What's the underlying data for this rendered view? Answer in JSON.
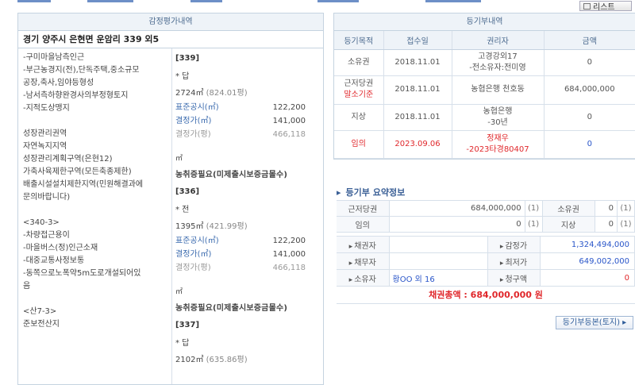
{
  "toolbar": {
    "print_label": "리스트"
  },
  "appraisal": {
    "header": "감정평가내역",
    "address": "경기 양주시 은현면 운암리 339 외5",
    "desc": [
      "-구미마을남측인근",
      "-부근농경지(전),단독주택,중소규모",
      "공장,축사,임야등형성",
      "-남서측하향완경사의부정형토지",
      "-지적도상맹지",
      "",
      "성장관리권역",
      "자연녹지지역",
      "성장관리계획구역(은현12)",
      "가축사육제한구역(모든축종제한)",
      "배출시설설치제한지역(민원해결과에",
      "문의바랍니다)",
      "",
      "<340-3>",
      "-차량접근용이",
      "-마을버스(정)인근소재",
      "-대중교통사정보통",
      "-동쪽으로노폭약5m도로개설되어있",
      "음",
      "",
      "<산7-3>",
      "준보전산지"
    ],
    "lots": [
      {
        "lot": "[339]",
        "kind": "* 답",
        "area": "2724㎡",
        "area_py": "(824.01평)",
        "official_label": "표준공시(㎡)",
        "official_value": "122,200",
        "decided_label": "결정가(㎡)",
        "decided_value": "141,000",
        "py_label": "결정가(평)",
        "py_value": "466,118",
        "unit": "㎡",
        "note": "농취증필요(미제출시보증금몰수)"
      },
      {
        "lot": "[336]",
        "kind": "* 전",
        "area": "1395㎡",
        "area_py": "(421.99평)",
        "official_label": "표준공시(㎡)",
        "official_value": "122,200",
        "decided_label": "결정가(㎡)",
        "decided_value": "141,000",
        "py_label": "결정가(평)",
        "py_value": "466,118",
        "unit": "㎡",
        "note": "농취증필요(미제출시보증금몰수)"
      },
      {
        "lot": "[337]",
        "kind": "* 답",
        "area": "2102㎡",
        "area_py": "(635.86평)"
      }
    ]
  },
  "registry": {
    "header": "등기부내역",
    "columns": [
      "등기목적",
      "접수일",
      "권리자",
      "금액"
    ],
    "rows": [
      {
        "purpose": "소유권",
        "purpose2": "",
        "date": "2018.11.01",
        "holder": "고경강외17",
        "holder2": "-전소유자:전미영",
        "amount": "0"
      },
      {
        "purpose": "근저당권",
        "purpose2": "말소기준",
        "date": "2018.11.01",
        "holder": "농협은행 천호동",
        "holder2": "",
        "amount": "684,000,000"
      },
      {
        "purpose": "지상",
        "purpose2": "",
        "date": "2018.11.01",
        "holder": "농협은행",
        "holder2": "-30년",
        "amount": "0"
      },
      {
        "purpose": "임의",
        "purpose2": "",
        "date": "2023.09.06",
        "holder": "정재우",
        "holder2": "-2023타경80407",
        "amount": "0"
      }
    ]
  },
  "summary": {
    "title": "등기부 요약정보",
    "rows": [
      {
        "k1": "근저당권",
        "v1": "684,000,000",
        "c1": "(1)",
        "k2": "소유권",
        "v2": "0",
        "c2": "(1)"
      },
      {
        "k1": "임의",
        "v1": "0",
        "c1": "(1)",
        "k2": "지상",
        "v2": "0",
        "c2": "(1)"
      }
    ],
    "parties": [
      {
        "k1": "채권자",
        "v1": "",
        "k2": "감정가",
        "v2": "1,324,494,000"
      },
      {
        "k1": "채무자",
        "v1": "",
        "k2": "최저가",
        "v2": "649,002,000"
      },
      {
        "k1": "소유자",
        "v1": "황OO 외 16",
        "k2": "청구액",
        "v2": "0"
      }
    ],
    "total": "채권총액 : 684,000,000 원",
    "button": "등기부등본(토지) ▸"
  }
}
